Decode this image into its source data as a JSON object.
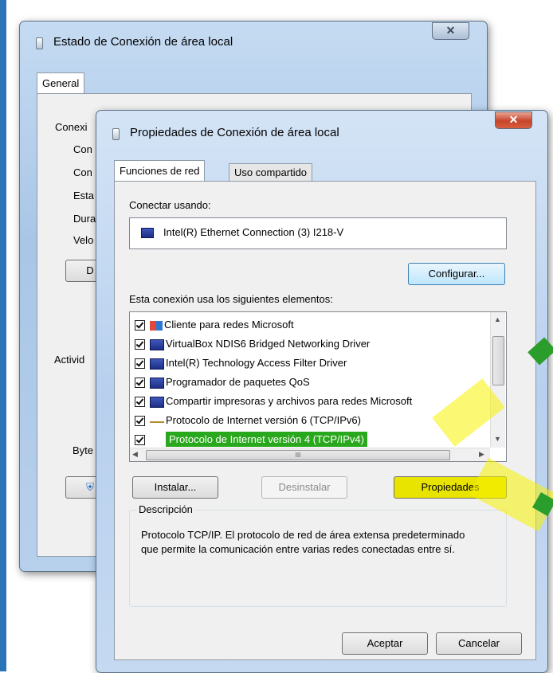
{
  "back_window": {
    "title": "Estado de Conexión de área local",
    "tab": "General",
    "labels": [
      "Conexi",
      "Con",
      "Con",
      "Esta",
      "Dura",
      "Velo",
      "D"
    ],
    "actividad": "Activid",
    "bytes": "Byte"
  },
  "dialog": {
    "title": "Propiedades de Conexión de área local",
    "tabs": [
      "Funciones de red",
      "Uso compartido"
    ],
    "connect_using_label": "Conectar usando:",
    "adapter": "Intel(R) Ethernet Connection (3) I218-V",
    "configure_button": "Configurar...",
    "elements_label": "Esta conexión usa los siguientes elementos:",
    "items": [
      {
        "label": "Cliente para redes Microsoft",
        "icon": "network-client-icon",
        "checked": true
      },
      {
        "label": "VirtualBox NDIS6 Bridged Networking Driver",
        "icon": "network-service-icon",
        "checked": true
      },
      {
        "label": "Intel(R) Technology Access Filter Driver",
        "icon": "network-service-icon",
        "checked": true
      },
      {
        "label": "Programador de paquetes QoS",
        "icon": "network-service-icon",
        "checked": true
      },
      {
        "label": "Compartir impresoras y archivos para redes Microsoft",
        "icon": "network-service-icon",
        "checked": true
      },
      {
        "label": "Protocolo de Internet versión 6 (TCP/IPv6)",
        "icon": "protocol-icon",
        "checked": true
      },
      {
        "label": "Protocolo de Internet versión 4 (TCP/IPv4)",
        "icon": "protocol-icon",
        "checked": true,
        "selected": true
      }
    ],
    "scroll_thumb": "III",
    "install_button": "Instalar...",
    "uninstall_button": "Desinstalar",
    "properties_button": "Propiedades",
    "description_legend": "Descripción",
    "description_text": "Protocolo TCP/IP. El protocolo de red de área extensa predeterminado que permite la comunicación entre varias redes conectadas entre sí.",
    "ok_button": "Aceptar",
    "cancel_button": "Cancelar"
  },
  "colors": {
    "highlight_green": "#2aa81d",
    "annotation_yellow": "#f7f300",
    "arrow_green": "#2a9d2c"
  }
}
